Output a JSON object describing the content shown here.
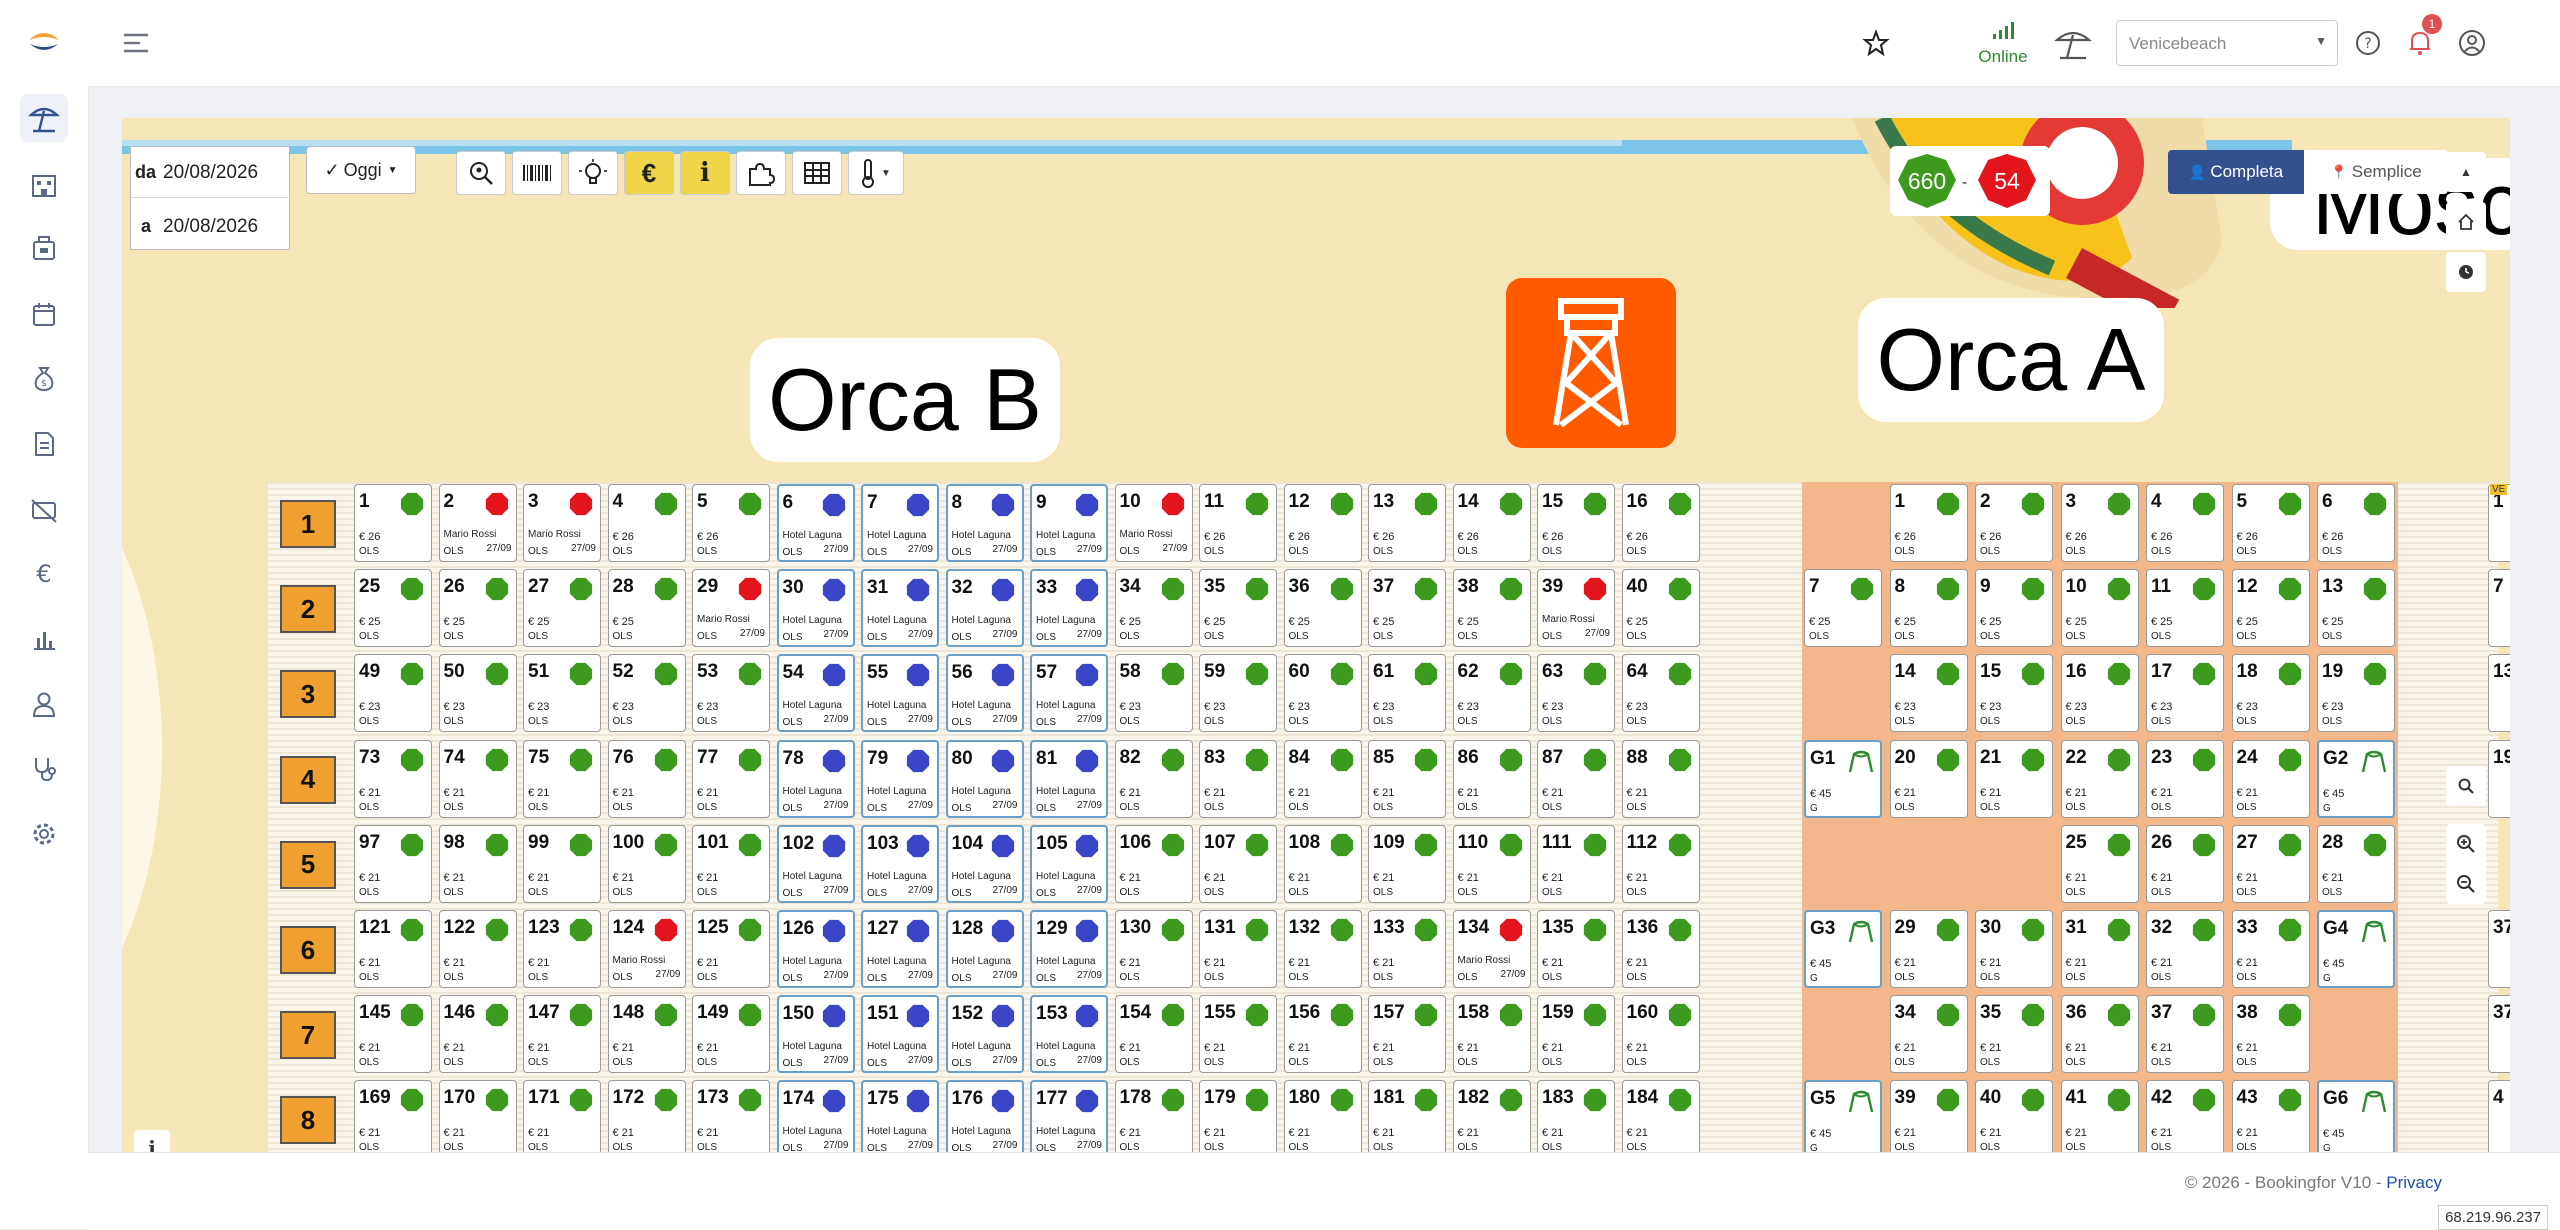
{
  "app": {
    "footer_text": "© 2026 - Bookingfor V10 - ",
    "privacy_label": "Privacy",
    "ip": "68.219.96.237"
  },
  "header": {
    "status_label": "Online",
    "location_value": "Venicebeach",
    "notification_count": "1"
  },
  "filters": {
    "from_label": "da",
    "from_value": "20/08/2026",
    "to_label": "a",
    "to_value": "20/08/2026",
    "today_label": "Oggi"
  },
  "view_modes": {
    "full_label": "Completa",
    "simple_label": "Semplice"
  },
  "counters": {
    "free": "660",
    "occupied": "54"
  },
  "zones": {
    "orca_b": "Orca B",
    "orca_a": "Orca A",
    "partial": "Mosc",
    "edge_label": "VE"
  },
  "grid_b": {
    "row_labels": [
      "1",
      "2",
      "3",
      "4",
      "5",
      "6",
      "7",
      "8"
    ],
    "rows": [
      {
        "price": "€ 26",
        "type": "OLS",
        "cells": [
          [
            "1",
            "free"
          ],
          [
            "2",
            "red",
            "Mario Rossi"
          ],
          [
            "3",
            "red",
            "Mario Rossi"
          ],
          [
            "4",
            "free"
          ],
          [
            "5",
            "free"
          ],
          [
            "6",
            "blue",
            "Hotel Laguna"
          ],
          [
            "7",
            "blue",
            "Hotel Laguna"
          ],
          [
            "8",
            "blue",
            "Hotel Laguna"
          ],
          [
            "9",
            "blue",
            "Hotel Laguna"
          ],
          [
            "10",
            "red",
            "Mario Rossi"
          ],
          [
            "11",
            "free"
          ],
          [
            "12",
            "free"
          ],
          [
            "13",
            "free"
          ],
          [
            "14",
            "free"
          ],
          [
            "15",
            "free"
          ],
          [
            "16",
            "free"
          ]
        ]
      },
      {
        "price": "€ 25",
        "type": "OLS",
        "cells": [
          [
            "25",
            "free"
          ],
          [
            "26",
            "free"
          ],
          [
            "27",
            "free"
          ],
          [
            "28",
            "free"
          ],
          [
            "29",
            "red",
            "Mario Rossi"
          ],
          [
            "30",
            "blue",
            "Hotel Laguna"
          ],
          [
            "31",
            "blue",
            "Hotel Laguna"
          ],
          [
            "32",
            "blue",
            "Hotel Laguna"
          ],
          [
            "33",
            "blue",
            "Hotel Laguna"
          ],
          [
            "34",
            "free"
          ],
          [
            "35",
            "free"
          ],
          [
            "36",
            "free"
          ],
          [
            "37",
            "free"
          ],
          [
            "38",
            "free"
          ],
          [
            "39",
            "red",
            "Mario Rossi"
          ],
          [
            "40",
            "free"
          ]
        ]
      },
      {
        "price": "€ 23",
        "type": "OLS",
        "cells": [
          [
            "49",
            "free"
          ],
          [
            "50",
            "free"
          ],
          [
            "51",
            "free"
          ],
          [
            "52",
            "free"
          ],
          [
            "53",
            "free"
          ],
          [
            "54",
            "blue",
            "Hotel Laguna"
          ],
          [
            "55",
            "blue",
            "Hotel Laguna"
          ],
          [
            "56",
            "blue",
            "Hotel Laguna"
          ],
          [
            "57",
            "blue",
            "Hotel Laguna"
          ],
          [
            "58",
            "free"
          ],
          [
            "59",
            "free"
          ],
          [
            "60",
            "free"
          ],
          [
            "61",
            "free"
          ],
          [
            "62",
            "free"
          ],
          [
            "63",
            "free"
          ],
          [
            "64",
            "free"
          ]
        ]
      },
      {
        "price": "€ 21",
        "type": "OLS",
        "cells": [
          [
            "73",
            "free"
          ],
          [
            "74",
            "free"
          ],
          [
            "75",
            "free"
          ],
          [
            "76",
            "free"
          ],
          [
            "77",
            "free"
          ],
          [
            "78",
            "blue",
            "Hotel Laguna"
          ],
          [
            "79",
            "blue",
            "Hotel Laguna"
          ],
          [
            "80",
            "blue",
            "Hotel Laguna"
          ],
          [
            "81",
            "blue",
            "Hotel Laguna"
          ],
          [
            "82",
            "free"
          ],
          [
            "83",
            "free"
          ],
          [
            "84",
            "free"
          ],
          [
            "85",
            "free"
          ],
          [
            "86",
            "free"
          ],
          [
            "87",
            "free"
          ],
          [
            "88",
            "free"
          ]
        ]
      },
      {
        "price": "€ 21",
        "type": "OLS",
        "cells": [
          [
            "97",
            "free"
          ],
          [
            "98",
            "free"
          ],
          [
            "99",
            "free"
          ],
          [
            "100",
            "free"
          ],
          [
            "101",
            "free"
          ],
          [
            "102",
            "blue",
            "Hotel Laguna"
          ],
          [
            "103",
            "blue",
            "Hotel Laguna"
          ],
          [
            "104",
            "blue",
            "Hotel Laguna"
          ],
          [
            "105",
            "blue",
            "Hotel Laguna"
          ],
          [
            "106",
            "free"
          ],
          [
            "107",
            "free"
          ],
          [
            "108",
            "free"
          ],
          [
            "109",
            "free"
          ],
          [
            "110",
            "free"
          ],
          [
            "111",
            "free"
          ],
          [
            "112",
            "free"
          ]
        ]
      },
      {
        "price": "€ 21",
        "type": "OLS",
        "cells": [
          [
            "121",
            "free"
          ],
          [
            "122",
            "free"
          ],
          [
            "123",
            "free"
          ],
          [
            "124",
            "red",
            "Mario Rossi"
          ],
          [
            "125",
            "free"
          ],
          [
            "126",
            "blue",
            "Hotel Laguna"
          ],
          [
            "127",
            "blue",
            "Hotel Laguna"
          ],
          [
            "128",
            "blue",
            "Hotel Laguna"
          ],
          [
            "129",
            "blue",
            "Hotel Laguna"
          ],
          [
            "130",
            "free"
          ],
          [
            "131",
            "free"
          ],
          [
            "132",
            "free"
          ],
          [
            "133",
            "free"
          ],
          [
            "134",
            "red",
            "Mario Rossi"
          ],
          [
            "135",
            "free"
          ],
          [
            "136",
            "free"
          ]
        ]
      },
      {
        "price": "€ 21",
        "type": "OLS",
        "cells": [
          [
            "145",
            "free"
          ],
          [
            "146",
            "free"
          ],
          [
            "147",
            "free"
          ],
          [
            "148",
            "free"
          ],
          [
            "149",
            "free"
          ],
          [
            "150",
            "blue",
            "Hotel Laguna"
          ],
          [
            "151",
            "blue",
            "Hotel Laguna"
          ],
          [
            "152",
            "blue",
            "Hotel Laguna"
          ],
          [
            "153",
            "blue",
            "Hotel Laguna"
          ],
          [
            "154",
            "free"
          ],
          [
            "155",
            "free"
          ],
          [
            "156",
            "free"
          ],
          [
            "157",
            "free"
          ],
          [
            "158",
            "free"
          ],
          [
            "159",
            "free"
          ],
          [
            "160",
            "free"
          ]
        ]
      },
      {
        "price": "€ 21",
        "type": "OLS",
        "cells": [
          [
            "169",
            "free"
          ],
          [
            "170",
            "free"
          ],
          [
            "171",
            "free"
          ],
          [
            "172",
            "free"
          ],
          [
            "173",
            "free"
          ],
          [
            "174",
            "blue",
            "Hotel Laguna"
          ],
          [
            "175",
            "blue",
            "Hotel Laguna"
          ],
          [
            "176",
            "blue",
            "Hotel Laguna"
          ],
          [
            "177",
            "blue",
            "Hotel Laguna"
          ],
          [
            "178",
            "free"
          ],
          [
            "179",
            "free"
          ],
          [
            "180",
            "free"
          ],
          [
            "181",
            "free"
          ],
          [
            "182",
            "free"
          ],
          [
            "183",
            "free"
          ],
          [
            "184",
            "free"
          ]
        ]
      }
    ],
    "booking_date": "27/09"
  },
  "grid_a": {
    "rows": [
      {
        "offset": 1,
        "price": "€ 26",
        "type": "OLS",
        "cells": [
          [
            "1",
            "free"
          ],
          [
            "2",
            "free"
          ],
          [
            "3",
            "free"
          ],
          [
            "4",
            "free"
          ],
          [
            "5",
            "free"
          ],
          [
            "6",
            "free"
          ]
        ]
      },
      {
        "offset": 0,
        "price": "€ 25",
        "type": "OLS",
        "cells": [
          [
            "7",
            "free"
          ],
          [
            "8",
            "free"
          ],
          [
            "9",
            "free"
          ],
          [
            "10",
            "free"
          ],
          [
            "11",
            "free"
          ],
          [
            "12",
            "free"
          ],
          [
            "13",
            "free"
          ]
        ]
      },
      {
        "offset": 1,
        "price": "€ 23",
        "type": "OLS",
        "cells": [
          [
            "14",
            "free"
          ],
          [
            "15",
            "free"
          ],
          [
            "16",
            "free"
          ],
          [
            "17",
            "free"
          ],
          [
            "18",
            "free"
          ],
          [
            "19",
            "free"
          ]
        ]
      },
      {
        "offset": 0,
        "price": "€ 21",
        "type": "OLS",
        "cells": [
          [
            "G1",
            "tent"
          ],
          [
            "20",
            "free"
          ],
          [
            "21",
            "free"
          ],
          [
            "22",
            "free"
          ],
          [
            "23",
            "free"
          ],
          [
            "24",
            "free"
          ],
          [
            "G2",
            "tent"
          ]
        ]
      },
      {
        "offset": 3,
        "price": "€ 21",
        "type": "OLS",
        "cells": [
          [
            "25",
            "free"
          ],
          [
            "26",
            "free"
          ],
          [
            "27",
            "free"
          ],
          [
            "28",
            "free"
          ]
        ]
      },
      {
        "offset": 0,
        "price": "€ 21",
        "type": "OLS",
        "cells": [
          [
            "G3",
            "tent"
          ],
          [
            "29",
            "free"
          ],
          [
            "30",
            "free"
          ],
          [
            "31",
            "free"
          ],
          [
            "32",
            "free"
          ],
          [
            "33",
            "free"
          ],
          [
            "G4",
            "tent"
          ]
        ]
      },
      {
        "offset": 1,
        "price": "€ 21",
        "type": "OLS",
        "cells": [
          [
            "34",
            "free"
          ],
          [
            "35",
            "free"
          ],
          [
            "36",
            "free"
          ],
          [
            "37",
            "free"
          ],
          [
            "38",
            "free"
          ]
        ]
      },
      {
        "offset": 0,
        "price": "€ 21",
        "type": "OLS",
        "cells": [
          [
            "G5",
            "tent"
          ],
          [
            "39",
            "free"
          ],
          [
            "40",
            "free"
          ],
          [
            "41",
            "free"
          ],
          [
            "42",
            "free"
          ],
          [
            "43",
            "free"
          ],
          [
            "G6",
            "tent"
          ]
        ]
      }
    ],
    "tent_price": "€ 45",
    "tent_type": "G",
    "edge_numbers": [
      "1",
      "7",
      "13",
      "19",
      "",
      "37",
      "37",
      "4"
    ]
  },
  "colors": {
    "free": "#3c9a1e",
    "red": "#e3141c",
    "blue": "#3b45c8",
    "accent": "#34518f",
    "sand": "#f5e6b8",
    "row_label": "#f0a030",
    "tower": "#ff5a00"
  }
}
